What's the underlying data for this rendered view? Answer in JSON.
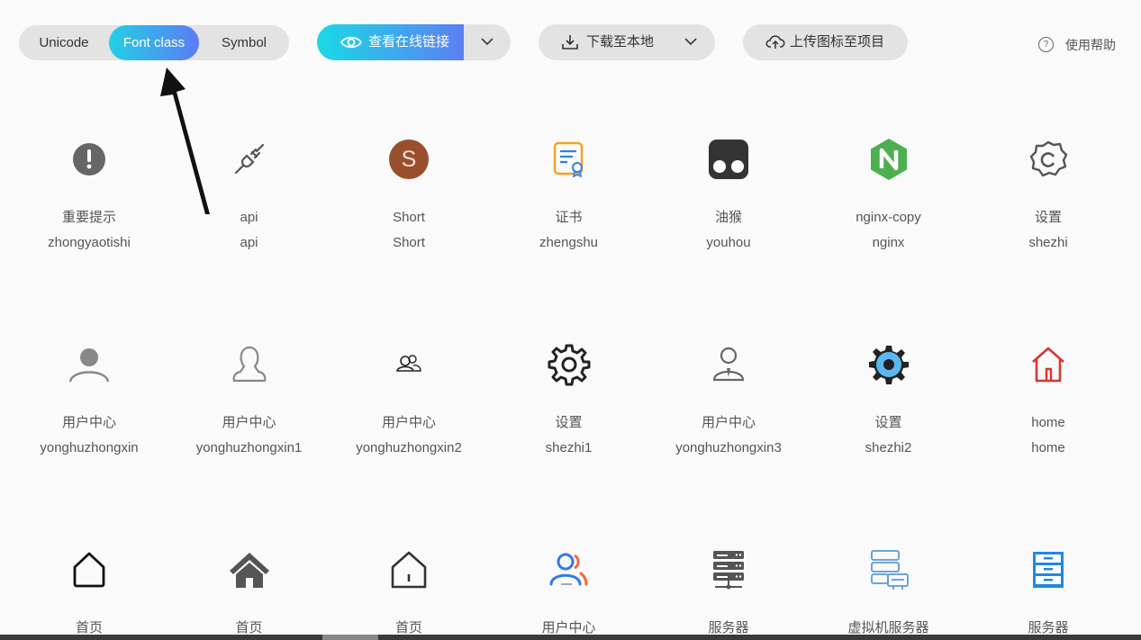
{
  "tabs": {
    "unicode": "Unicode",
    "fontclass": "Font class",
    "symbol": "Symbol"
  },
  "toolbar": {
    "preview_label": "查看在线链接",
    "download_label": "下载至本地",
    "upload_label": "上传图标至项目",
    "help_label": "使用帮助",
    "help_mark": "?"
  },
  "icons": [
    {
      "name": "重要提示",
      "cls": "zhongyaotishi",
      "icon": "exclamation-circle-icon"
    },
    {
      "name": "api",
      "cls": "api",
      "icon": "plug-icon"
    },
    {
      "name": "Short",
      "cls": "Short",
      "icon": "letter-s-circle-icon",
      "letter": "S"
    },
    {
      "name": "证书",
      "cls": "zhengshu",
      "icon": "certificate-icon"
    },
    {
      "name": "油猴",
      "cls": "youhou",
      "icon": "tampermonkey-icon"
    },
    {
      "name": "nginx-copy",
      "cls": "nginx",
      "icon": "nginx-hexagon-icon",
      "letter": "N"
    },
    {
      "name": "设置",
      "cls": "shezhi",
      "icon": "gear-outline-icon"
    },
    {
      "name": "用户中心",
      "cls": "yonghuzhongxin",
      "icon": "user-filled-icon"
    },
    {
      "name": "用户中心",
      "cls": "yonghuzhongxin1",
      "icon": "user-outline-icon"
    },
    {
      "name": "用户中心",
      "cls": "yonghuzhongxin2",
      "icon": "users-group-icon"
    },
    {
      "name": "设置",
      "cls": "shezhi1",
      "icon": "gear-icon"
    },
    {
      "name": "用户中心",
      "cls": "yonghuzhongxin3",
      "icon": "user-tie-icon"
    },
    {
      "name": "设置",
      "cls": "shezhi2",
      "icon": "gear-blue-icon"
    },
    {
      "name": "home",
      "cls": "home",
      "icon": "home-red-icon"
    },
    {
      "name": "首页",
      "cls": "",
      "icon": "home-outline-icon"
    },
    {
      "name": "首页",
      "cls": "",
      "icon": "home-filled-icon"
    },
    {
      "name": "首页",
      "cls": "",
      "icon": "home-door-icon"
    },
    {
      "name": "用户中心",
      "cls": "",
      "icon": "users-colored-icon"
    },
    {
      "name": "服务器",
      "cls": "",
      "icon": "server-rack-icon"
    },
    {
      "name": "虚拟机服务器",
      "cls": "",
      "icon": "virtual-server-icon"
    },
    {
      "name": "服务器",
      "cls": "",
      "icon": "server-blue-icon"
    }
  ],
  "colors": {
    "accent_start": "#19d9e6",
    "accent_end": "#5d7ff3",
    "nginx": "#4caf50",
    "short": "#9a4f2c",
    "home_red": "#d9362f",
    "blue": "#1e88e5"
  }
}
